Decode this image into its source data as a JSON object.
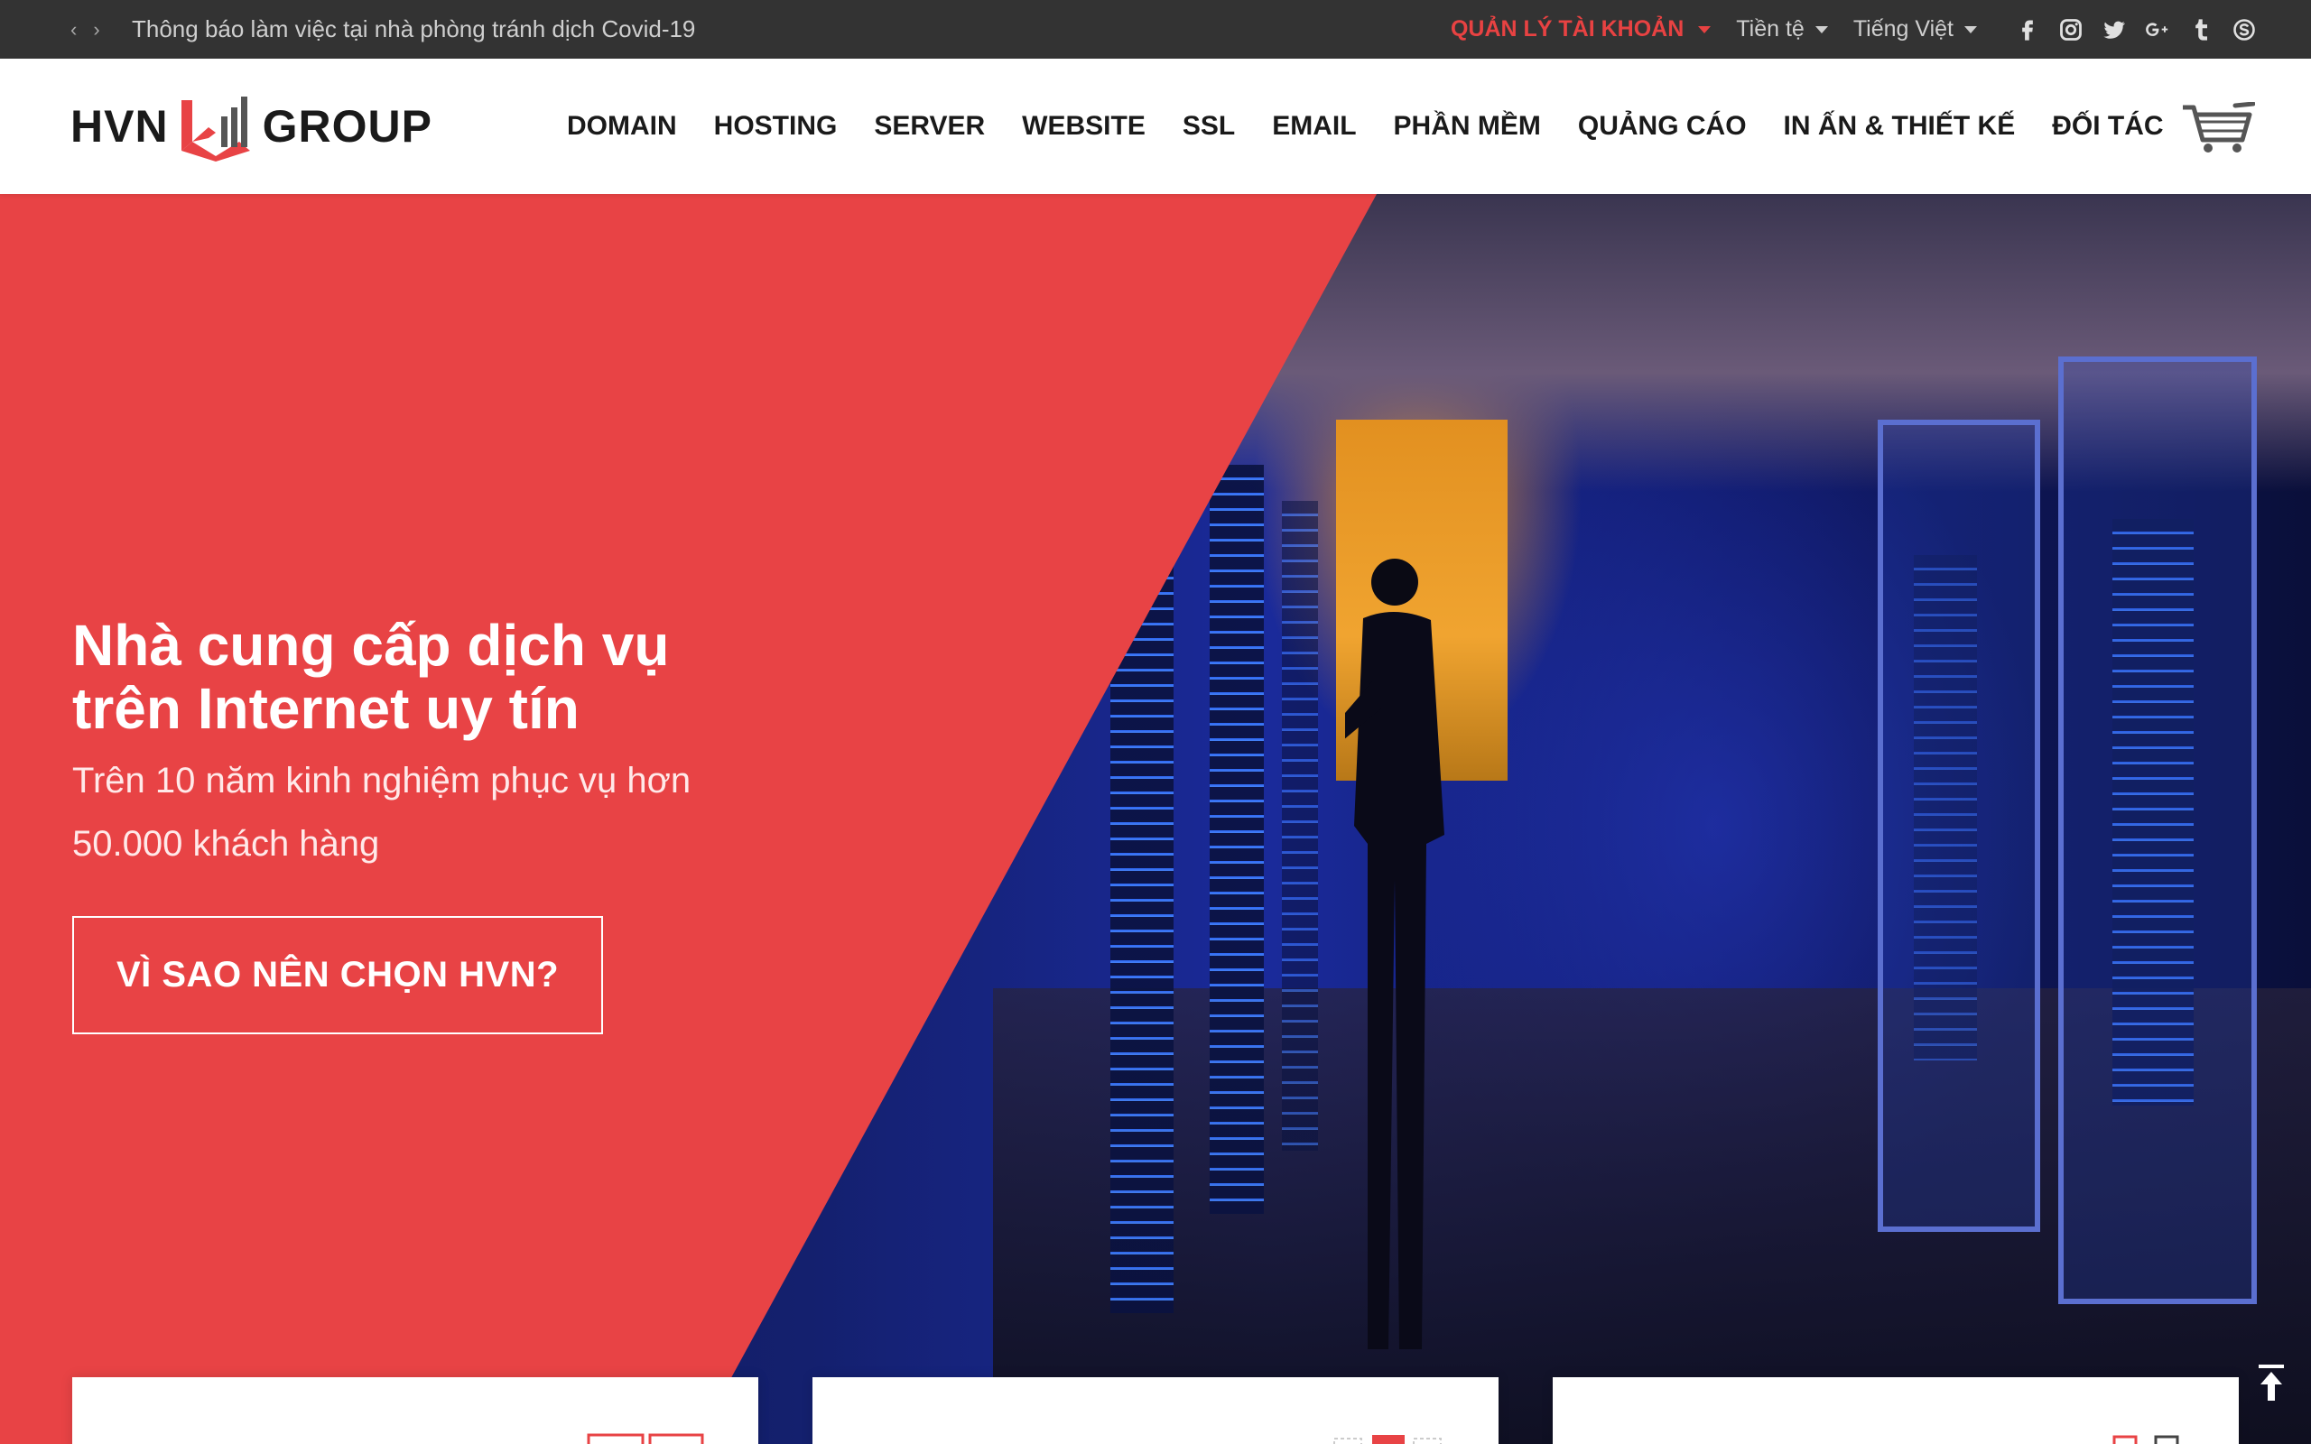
{
  "topbar": {
    "prev_arrow": "‹",
    "next_arrow": "›",
    "notice": "Thông báo làm việc tại nhà phòng tránh dịch Covid-19",
    "account": "QUẢN LÝ TÀI KHOẢN",
    "currency": "Tiền tệ",
    "language": "Tiếng Việt"
  },
  "logo": {
    "left": "HVN",
    "right": "GROUP"
  },
  "nav": {
    "items": [
      "DOMAIN",
      "HOSTING",
      "SERVER",
      "WEBSITE",
      "SSL",
      "EMAIL",
      "PHẦN MỀM",
      "QUẢNG CÁO",
      "IN ẤN & THIẾT KẾ",
      "ĐỐI TÁC"
    ]
  },
  "hero": {
    "title": "Nhà cung cấp dịch vụ trên Internet uy tín",
    "subtitle": "Trên 10 năm kinh nghiệm phục vụ hơn 50.000 khách hàng",
    "cta": "VÌ SAO NÊN CHỌN HVN?"
  },
  "colors": {
    "brand_red": "#e84345",
    "topbar": "#333333",
    "account_red": "#e84242"
  },
  "icons": [
    "facebook-icon",
    "instagram-icon",
    "twitter-icon",
    "google-plus-icon",
    "tumblr-icon",
    "skype-icon",
    "cart-icon",
    "back-to-top-icon"
  ]
}
